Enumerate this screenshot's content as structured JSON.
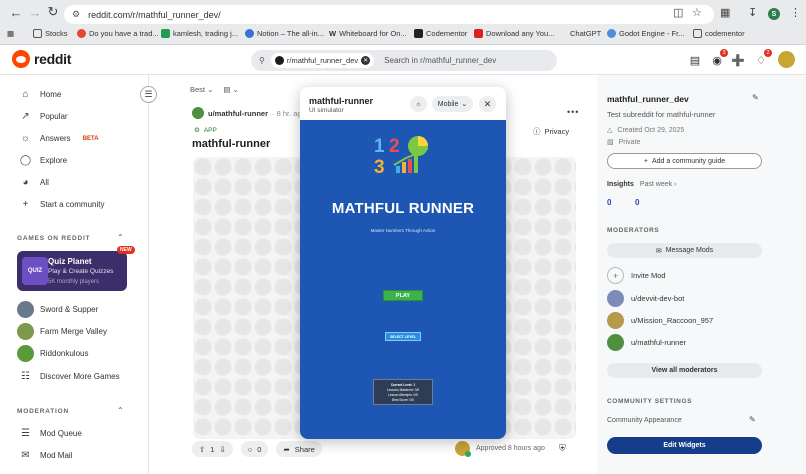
{
  "browser": {
    "url": "reddit.com/r/mathful_runner_dev/",
    "profile_initial": "S",
    "bookmarks": [
      {
        "label": "Stocks",
        "color": "#6b6f75"
      },
      {
        "label": "Do you have a trad...",
        "color": "#e24a2f"
      },
      {
        "label": "kamlesh, trading j...",
        "color": "#1f9d55"
      },
      {
        "label": "Notion – The all-in...",
        "color": "#3d6fd6"
      },
      {
        "label": "Whiteboard for On...",
        "color": "#222222"
      },
      {
        "label": "Codementor",
        "color": "#222222"
      },
      {
        "label": "Download any You...",
        "color": "#e02020"
      },
      {
        "label": "ChatGPT",
        "color": "#ffffff"
      },
      {
        "label": "Godot Engine - Fr...",
        "color": "#4a8fd8"
      },
      {
        "label": "codementor",
        "color": "#6b6f75"
      }
    ]
  },
  "header": {
    "logo_text": "reddit",
    "search_chip": "r/mathful_runner_dev",
    "search_placeholder": "Search in r/mathful_runner_dev",
    "chat_badge": "3",
    "notif_badge": "2"
  },
  "sidebar": {
    "nav": [
      {
        "label": "Home",
        "icon": "home-icon"
      },
      {
        "label": "Popular",
        "icon": "popular-icon"
      },
      {
        "label": "Answers",
        "icon": "answers-icon",
        "badge": "BETA"
      },
      {
        "label": "Explore",
        "icon": "explore-icon"
      },
      {
        "label": "All",
        "icon": "all-icon"
      },
      {
        "label": "Start a community",
        "icon": "plus-icon"
      }
    ],
    "games_heading": "GAMES ON REDDIT",
    "quiz_card": {
      "logo": "QUIZ",
      "title": "Quiz Planet",
      "subtitle": "Play & Create Quizzes",
      "players": "5K monthly players",
      "new_badge": "NEW"
    },
    "games": [
      {
        "label": "Sword & Supper",
        "color": "#6a7a8c"
      },
      {
        "label": "Farm Merge Valley",
        "color": "#7c9a4b"
      },
      {
        "label": "Riddonkulous",
        "color": "#5b9a3a"
      }
    ],
    "discover_label": "Discover More Games",
    "moderation_heading": "MODERATION",
    "moderation": [
      {
        "label": "Mod Queue",
        "icon": "mod-queue-icon"
      },
      {
        "label": "Mod Mail",
        "icon": "mod-mail-icon"
      }
    ]
  },
  "feed": {
    "sort_label": "Best",
    "post": {
      "author": "u/mathful-runner",
      "time": "· 8 hr. ag",
      "tag": "APP",
      "title": "mathful-runner",
      "privacy": "Privacy",
      "votes": "1",
      "comments": "0",
      "share": "Share",
      "approved": "Approved 8 hours ago"
    }
  },
  "modal": {
    "title": "mathful-runner",
    "subtitle": "UI simulator",
    "device": "Mobile",
    "game": {
      "title": "MATHFUL RUNNER",
      "subtitle": "Master Numbers Through Action",
      "play": "PLAY",
      "select_level": "SELECT LEVEL",
      "info_lines": [
        "Current Level: 1",
        "Lessons Mastered: 0/5",
        "Lesson Attempts: 0/5",
        "Best Score: 0/5"
      ],
      "logo_digits": [
        "1",
        "2",
        "3"
      ]
    }
  },
  "right_sidebar": {
    "title": "mathful_runner_dev",
    "description": "Test subreddit for mathful-runner",
    "created": "Created Oct 29, 2025",
    "visibility": "Private",
    "guide_button": "Add a community guide",
    "insights_label": "Insights",
    "insights_period": "Past week",
    "stats": [
      "0",
      "0"
    ],
    "moderators_heading": "MODERATORS",
    "message_mods": "Message Mods",
    "invite_mod": "Invite Mod",
    "mods": [
      {
        "name": "u/devvit-dev-bot",
        "color": "#7d8bb8"
      },
      {
        "name": "u/Mission_Raccoon_957",
        "color": "#b49a4a"
      },
      {
        "name": "u/mathful-runner",
        "color": "#4f8f3f"
      }
    ],
    "view_all": "View all moderators",
    "settings_heading": "COMMUNITY SETTINGS",
    "community_appearance": "Community Appearance",
    "edit_widgets": "Edit Widgets"
  }
}
